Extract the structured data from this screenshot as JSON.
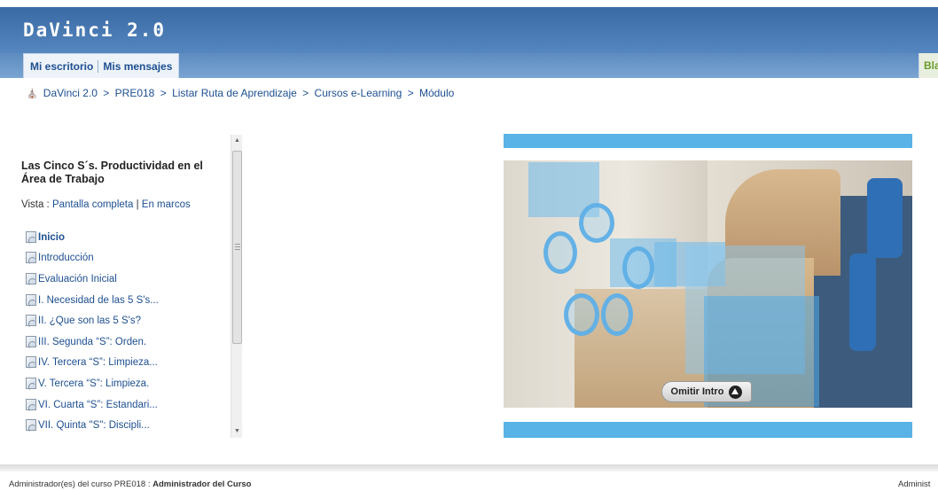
{
  "app": {
    "title": "DaVinci 2.0"
  },
  "tabs": [
    {
      "label": "Mi escritorio"
    },
    {
      "label": "Mis mensajes"
    }
  ],
  "right_tab": {
    "label": "Bla"
  },
  "breadcrumb": {
    "items": [
      "DaVinci 2.0",
      "PRE018",
      "Listar Ruta de Aprendizaje",
      "Cursos e-Learning",
      "Módulo"
    ],
    "separator": ">"
  },
  "sidebar": {
    "course_title": "Las Cinco S´s. Productividad en el Área de Trabajo",
    "vista_label": "Vista :",
    "vista_full": "Pantalla completa",
    "vista_sep": "|",
    "vista_frames": "En marcos",
    "items": [
      {
        "label": "Inicio"
      },
      {
        "label": "Introducción"
      },
      {
        "label": "Evaluación Inicial"
      },
      {
        "label": "I. Necesidad de las 5 S's..."
      },
      {
        "label": "II. ¿Que son las 5 S's?"
      },
      {
        "label": "III. Segunda “S”: Orden."
      },
      {
        "label": "IV. Tercera “S”: Limpieza..."
      },
      {
        "label": "V. Tercera “S”: Limpieza."
      },
      {
        "label": "VI. Cuarta “S”: Estandari..."
      },
      {
        "label": "VII. Quinta \"S\": Discipli..."
      }
    ]
  },
  "player": {
    "skip_label": "Omitir Intro"
  },
  "footer": {
    "prefix": "Administrador(es) del curso PRE018 :",
    "admin_name": "Administrador del Curso",
    "right_text": "Administ"
  },
  "colors": {
    "header_blue": "#4c7eb6",
    "link_blue": "#1d4f91",
    "accent_green": "#6a9c2a",
    "player_blue": "#59b3e6"
  }
}
